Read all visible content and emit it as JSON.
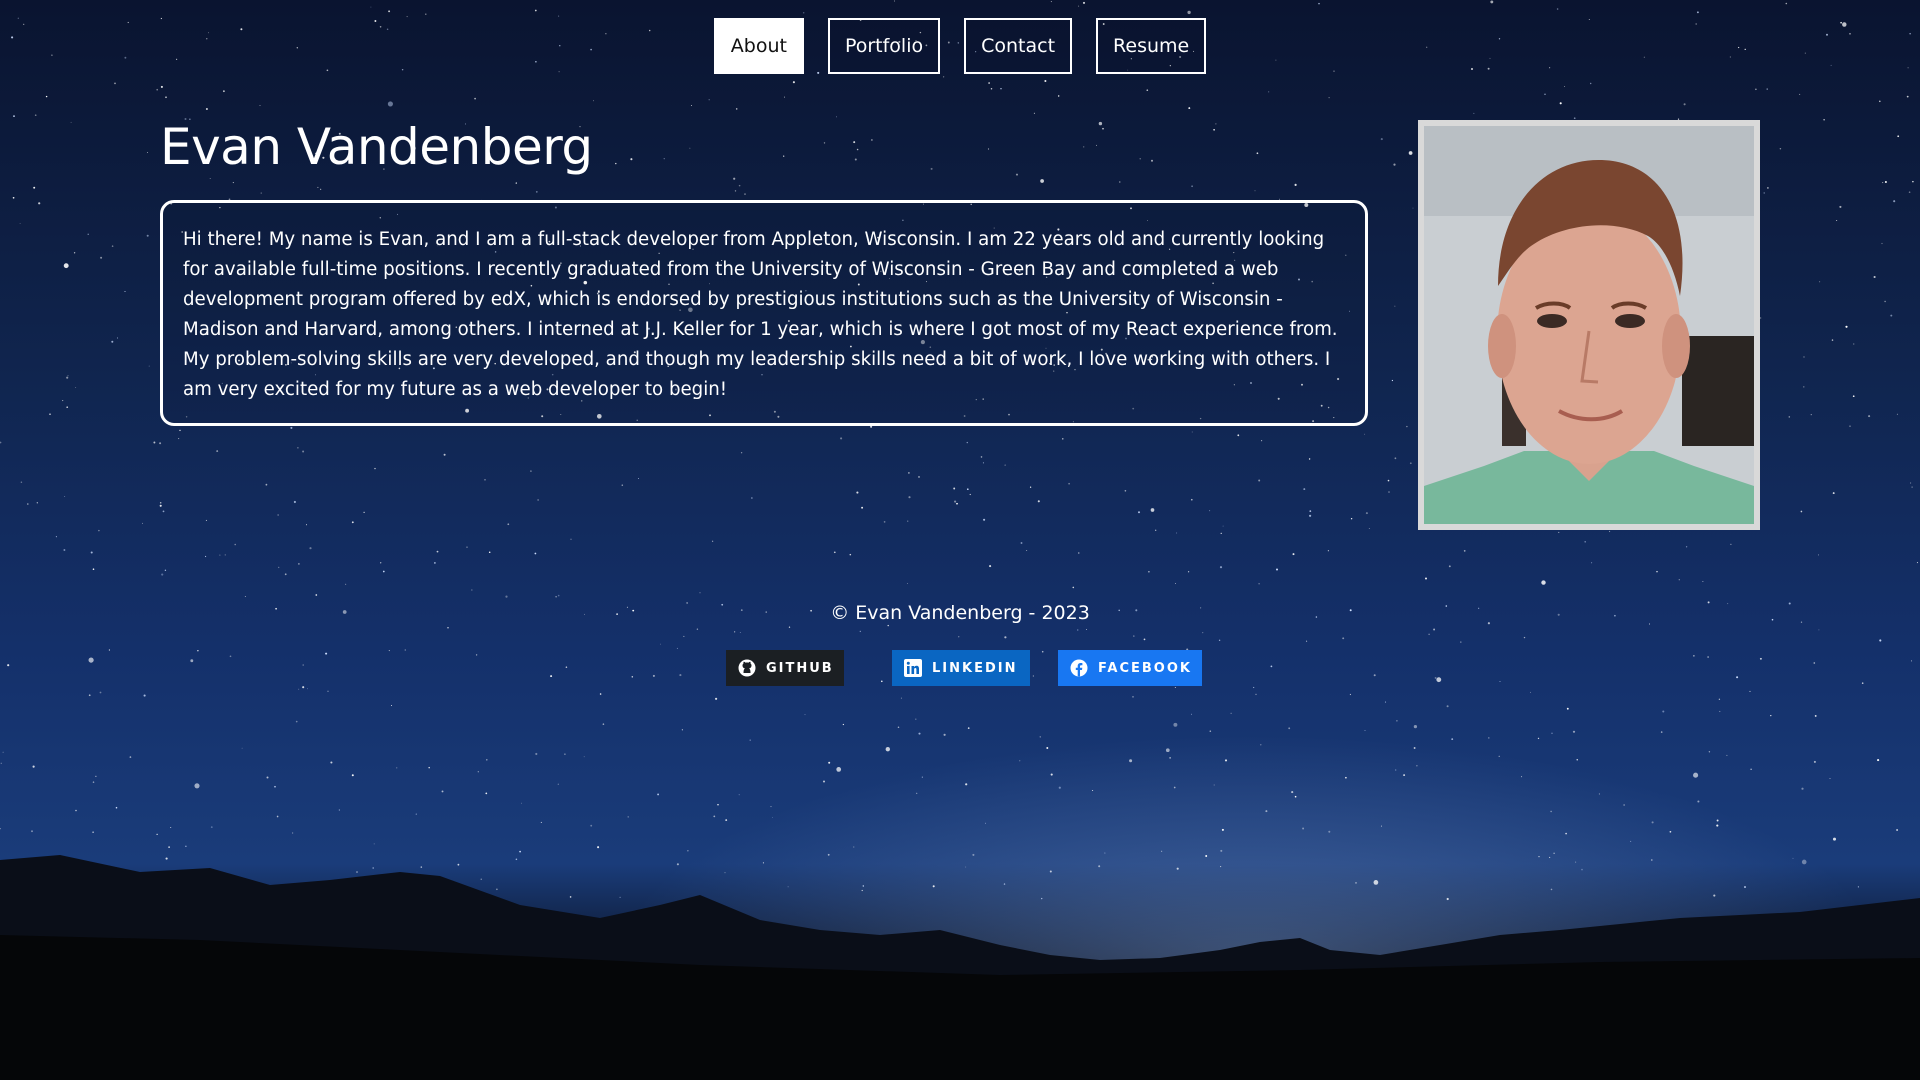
{
  "nav": {
    "items": [
      {
        "label": "About",
        "active": true
      },
      {
        "label": "Portfolio",
        "active": false
      },
      {
        "label": "Contact",
        "active": false
      },
      {
        "label": "Resume",
        "active": false
      }
    ]
  },
  "main": {
    "title": "Evan Vandenberg",
    "bio": "Hi there! My name is Evan, and I am a full-stack developer from Appleton, Wisconsin. I am 22 years old and currently looking for available full-time positions. I recently graduated from the University of Wisconsin - Green Bay and completed a web development program offered by edX, which is endorsed by prestigious institutions such as the University of Wisconsin - Madison and Harvard, among others. I interned at J.J. Keller for 1 year, which is where I got most of my React experience from. My problem-solving skills are very developed, and though my leadership skills need a bit of work, I love working with others. I am very excited for my future as a web developer to begin!"
  },
  "footer": {
    "copyright": "© Evan Vandenberg - 2023",
    "socials": [
      {
        "label": "GITHUB",
        "icon": "github-icon",
        "color": "#1b1f23"
      },
      {
        "label": "LINKEDIN",
        "icon": "linkedin-icon",
        "color": "#0a66c2"
      },
      {
        "label": "FACEBOOK",
        "icon": "facebook-icon",
        "color": "#1877f2"
      }
    ]
  },
  "colors": {
    "nav_active_bg": "#ffffff",
    "border": "#ffffff"
  }
}
